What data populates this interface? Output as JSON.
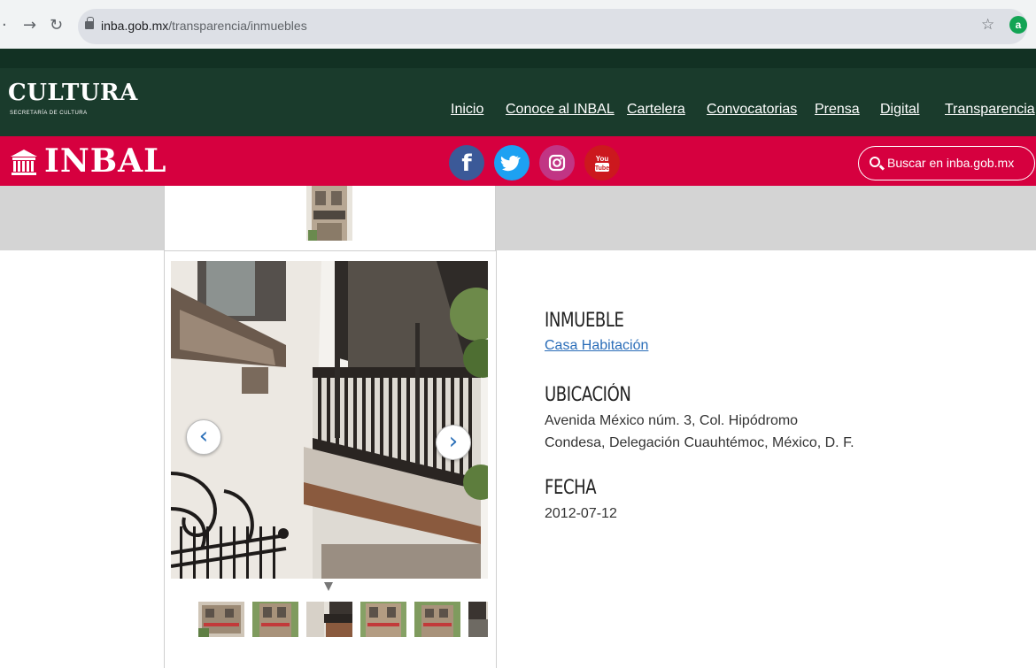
{
  "browser": {
    "back_icon": "arrow-left-icon",
    "forward_icon": "arrow-right-icon",
    "reload_icon": "reload-icon",
    "url_domain": "inba.gob.mx",
    "url_path": "/transparencia/inmuebles",
    "extension_badge": "a"
  },
  "header": {
    "logo": "CULTURA",
    "logo_sub": "SECRETARÍA DE CULTURA",
    "nav": [
      "Inicio",
      "Conoce al INBAL",
      "Cartelera",
      "Convocatorias",
      "Prensa",
      "Digital",
      "Transparencia"
    ]
  },
  "inbal": {
    "logo": "INBAL",
    "social": [
      {
        "label": "f",
        "icon": "facebook-icon",
        "color": "#3b5998"
      },
      {
        "label": "•",
        "icon": "twitter-icon",
        "color": "#1da1f2"
      },
      {
        "label": "◎",
        "icon": "instagram-icon",
        "color": "#c13584"
      },
      {
        "label": "You Tube",
        "icon": "youtube-icon",
        "color": "#cc181e"
      }
    ],
    "search_placeholder": "Buscar en inba.gob.mx"
  },
  "gallery": {
    "prev_icon": "chevron-left-icon",
    "next_icon": "chevron-right-icon",
    "prev_glyph": "‹",
    "next_glyph": "›",
    "thumbnail_count": 6
  },
  "info": {
    "inmueble_heading": "INMUEBLE",
    "inmueble_value": "Casa Habitación",
    "ubicacion_heading": "UBICACIÓN",
    "ubicacion_value": "Avenida México núm. 3, Col. Hipódromo Condesa, Delegación Cuauhtémoc, México, D. F.",
    "fecha_heading": "FECHA",
    "fecha_value": "2012-07-12"
  },
  "colors": {
    "header_green": "#1a3b2c",
    "inbal_red": "#d6003f",
    "link_blue": "#2a6db8"
  }
}
